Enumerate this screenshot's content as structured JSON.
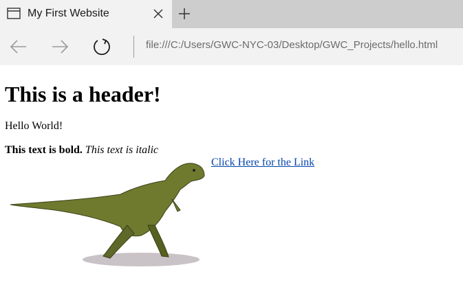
{
  "browser": {
    "tab_title": "My First Website",
    "url": "file:///C:/Users/GWC-NYC-03/Desktop/GWC_Projects/hello.html",
    "icons": {
      "tab": "page-icon",
      "close": "close-icon",
      "new_tab": "plus-icon",
      "back": "back-arrow-icon",
      "forward": "forward-arrow-icon",
      "refresh": "refresh-icon"
    }
  },
  "page": {
    "header": "This is a header!",
    "paragraph": "Hello World!",
    "bold_text": "This text is bold.",
    "italic_text": "This text is italic",
    "link_text": "Click Here for the Link",
    "link_color": "#0645ad"
  }
}
